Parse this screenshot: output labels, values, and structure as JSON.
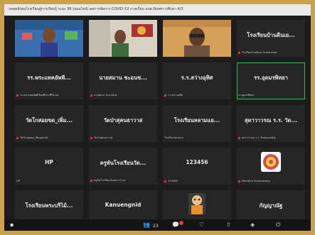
{
  "window": {
    "title": "กลยุทธ์ของโรงเรียนสู่การเรียนรู้ ระยะ 3R (ออนไลน์) ผลการจัดการ COVID-19 ภาคเรียน อบต.นิเทศการศึกษา 4/3"
  },
  "tiles": [
    {
      "name": "",
      "sub": "",
      "video": "person-1"
    },
    {
      "name": "",
      "sub": "",
      "video": "person-2"
    },
    {
      "name": "",
      "sub": "",
      "video": "person-3"
    },
    {
      "name": "โรงเรียนบ้านดินเย...",
      "sub": "โรงเรียนบ้านดินเย Screenshot",
      "video": ""
    },
    {
      "name": "รร.พระแทคอัพพี...",
      "sub": "รร.พระแทคอัพพีเรียนศึกษาคีรีธรรม",
      "video": ""
    },
    {
      "name": "นายสมาน ชะอนช...",
      "sub": "นายสมาน ชะอนช่วย",
      "video": ""
    },
    {
      "name": "ร.ร.สว่างอุทิศ",
      "sub": "ร.ร.สว่างอุทิศ",
      "video": ""
    },
    {
      "name": "รร.อุดมรพิทยา",
      "sub": "รร.อุดมรพิทยา",
      "video": "",
      "active": true
    },
    {
      "name": "วัดโกสอยขด_เพิ่ม...",
      "sub": "วัดโกสอยขด_เพิ่มอุปกรณ์",
      "video": ""
    },
    {
      "name": "วัดป่าสุคนธาวาส",
      "sub": "วัดป่าสุคนธาวาส",
      "video": ""
    },
    {
      "name": "โรงเรียนหลามแย...",
      "sub": "โรงเรียนหลามแย",
      "video": ""
    },
    {
      "name": "สุดาวาวรณ ร.ร. วัด...",
      "sub": "สุดาวาวรณ ร.ร. วัดสมดอกพรุ่ง",
      "video": ""
    },
    {
      "name": "HP",
      "sub": "HP",
      "video": ""
    },
    {
      "name": "ครูพันโรงเรียนวัด...",
      "sub": "ครูพันโรงเรียนวัดชนะการาม",
      "video": ""
    },
    {
      "name": "123456",
      "sub": "123456",
      "video": ""
    },
    {
      "name": "",
      "sub": "Monthira Sompraseng",
      "video": "logo"
    },
    {
      "name": "โรงเรียนพระบริไม้...",
      "sub": "โรงเรียนพระบริไม้ศึกษาลยนขอรพรรณ",
      "video": ""
    },
    {
      "name": "Kanuengnid",
      "sub": "Kanuengnid",
      "video": ""
    },
    {
      "name": "",
      "sub": "Wutthiput Kamsombo",
      "video": "cartoon"
    },
    {
      "name": "กัญญาณัฐ",
      "sub": "กัญญาณัฐ",
      "video": ""
    }
  ],
  "toolbar": {
    "participants_count": "23",
    "chat_icon": "chat-icon",
    "reactions_icon": "reactions-icon",
    "share_icon": "share-icon",
    "apps_icon": "apps-icon",
    "leave_icon": "leave-icon"
  },
  "colors": {
    "frame": "#c8a24e",
    "active_border": "#2fbf4f",
    "muted_mic": "#e03b3b"
  }
}
